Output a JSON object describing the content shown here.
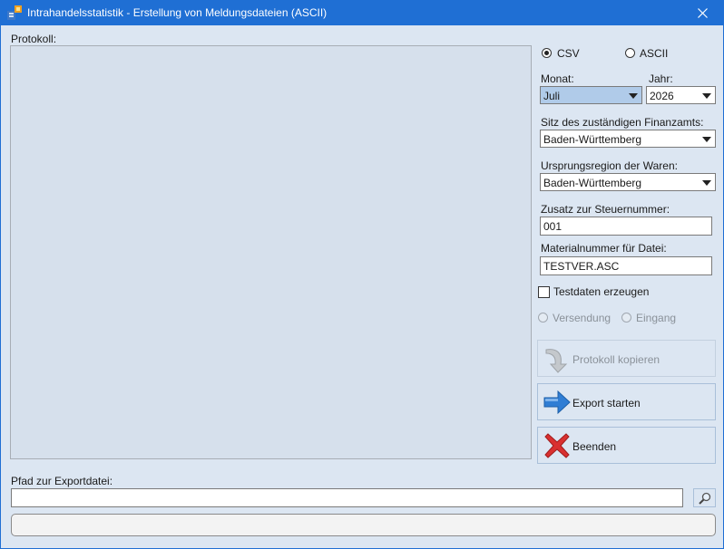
{
  "window": {
    "title": "Intrahandelsstatistik - Erstellung von Meldungsdateien (ASCII)"
  },
  "protokoll": {
    "label": "Protokoll:"
  },
  "format": {
    "csv_label": "CSV",
    "ascii_label": "ASCII",
    "selected": "CSV"
  },
  "monat": {
    "label": "Monat:",
    "value": "Juli"
  },
  "jahr": {
    "label": "Jahr:",
    "value": "2026"
  },
  "finanzamt": {
    "label": "Sitz des zuständigen Finanzamts:",
    "value": "Baden-Württemberg"
  },
  "region": {
    "label": "Ursprungsregion der Waren:",
    "value": "Baden-Württemberg"
  },
  "zusatz": {
    "label": "Zusatz zur Steuernummer:",
    "value": "001"
  },
  "material": {
    "label": "Materialnummer für Datei:",
    "value": "TESTVER.ASC"
  },
  "testdaten": {
    "label": "Testdaten erzeugen",
    "checked": false
  },
  "richtung": {
    "versendung_label": "Versendung",
    "eingang_label": "Eingang"
  },
  "buttons": {
    "kopieren_label": "Protokoll kopieren",
    "export_label": "Export starten",
    "beenden_label": "Beenden"
  },
  "export": {
    "label": "Pfad zur Exportdatei:",
    "value": ""
  },
  "progress": {
    "fraction": 0
  },
  "colors": {
    "titlebar": "#1f6fd4",
    "window_bg": "#dce6f2",
    "export_arrow": "#2f7dd4",
    "beenden_x": "#d93030"
  }
}
